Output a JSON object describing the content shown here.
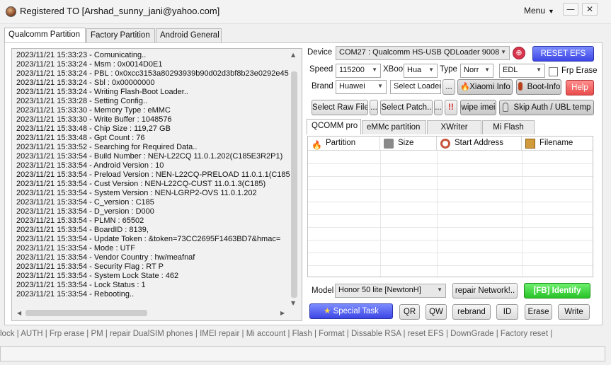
{
  "window": {
    "title": "Registered TO [Arshad_sunny_jani@yahoo.com]",
    "menu_label": "Menu",
    "minimize_label": "—",
    "close_label": "✕"
  },
  "tabs": [
    "Qualcomm Partition",
    "Factory Partition",
    "Android General"
  ],
  "log": [
    "2023/11/21 15:33:23 - Comunicating..",
    "2023/11/21 15:33:24 - Msm : 0x0014D0E1",
    "2023/11/21 15:33:24 - PBL : 0x0xcc3153a80293939b90d02d3bf8b23e0292e45",
    "2023/11/21 15:33:24 - Sbl : 0x00000000",
    "2023/11/21 15:33:24 - Writing Flash-Boot Loader..",
    "2023/11/21 15:33:28 - Setting Config..",
    "2023/11/21 15:33:30 - Memory Type : eMMC",
    "2023/11/21 15:33:30 - Write Buffer : 1048576",
    "2023/11/21 15:33:48 - Chip Size : 119,27 GB",
    "2023/11/21 15:33:48 - Gpt Count : 76",
    "2023/11/21 15:33:52 - Searching for Required Data..",
    "2023/11/21 15:33:54 - Build Number : NEN-L22CQ 11.0.1.202(C185E3R2P1)",
    "2023/11/21 15:33:54 - Android Version : 10",
    "2023/11/21 15:33:54 - Preload Version : NEN-L22CQ-PRELOAD 11.0.1.1(C185",
    "2023/11/21 15:33:54 - Cust Version : NEN-L22CQ-CUST 11.0.1.3(C185)",
    "2023/11/21 15:33:54 - System Version : NEN-LGRP2-OVS 11.0.1.202",
    "2023/11/21 15:33:54 - C_version : C185",
    "2023/11/21 15:33:54 - D_version : D000",
    "2023/11/21 15:33:54 - PLMN : 65502",
    "2023/11/21 15:33:54 - BoardID : 8139,",
    "2023/11/21 15:33:54 - Update Token : &token=73CC2695F1463BD7&hmac=",
    "2023/11/21 15:33:54 - Mode : UTF",
    "2023/11/21 15:33:54 - Vendor Country : hw/meafnaf",
    "2023/11/21 15:33:54 - Security Flag : RT P",
    "2023/11/21 15:33:54 - System Lock State : 462",
    "2023/11/21 15:33:54 - Lock Status : 1",
    "2023/11/21 15:33:54 - Rebooting.."
  ],
  "device": {
    "label": "Device",
    "value": "COM27 : Qualcomm HS-USB QDLoader 9008",
    "reset_efs": "RESET EFS"
  },
  "speed": {
    "label": "Speed",
    "value": "115200",
    "xboot_label": "XBoot",
    "xboot_value": "Hua",
    "type_label": "Type",
    "type_value": "Norr",
    "mode_value": "EDL",
    "frp_label": "Frp Erase"
  },
  "brand": {
    "label": "Brand",
    "value": "Huawei",
    "select_loader": "Select Loader",
    "ellipsis": "...",
    "xiaomi_info": "Xiaomi Info",
    "boot_info": "Boot-Info",
    "help": "Help"
  },
  "row4": {
    "select_raw": "Select Raw File",
    "ellipsis": "...",
    "select_patch": "Select Patch..",
    "exclaim": "!!",
    "wipe_imei": "wipe imei",
    "skip_auth": "Skip Auth / UBL temp"
  },
  "inner_tabs": [
    "QCOMM pro",
    "eMMc partition",
    "XWriter",
    "Mi Flash"
  ],
  "grid_headers": [
    "Partition",
    "Size",
    "Start Address",
    "Filename"
  ],
  "model": {
    "label": "Model",
    "value": "Honor 50 lite [NewtonH]",
    "repair_network": "repair Network!..",
    "fb_identify": "[FB] Identify"
  },
  "bottom_buttons": {
    "special_task": "Special Task",
    "qr": "QR",
    "qw": "QW",
    "rebrand": "rebrand",
    "id": "ID",
    "erase": "Erase",
    "write": "Write"
  },
  "status_strip": "lock | AUTH | Frp erase | PM | repair DualSIM phones | IMEI repair | Mi account | Flash | Format | Dissable RSA | reset EFS | DownGrade | Factory reset |",
  "colors": {
    "accent_blue": "#3d46e5",
    "help_red": "#e84b4b",
    "identify_green": "#27c227"
  }
}
